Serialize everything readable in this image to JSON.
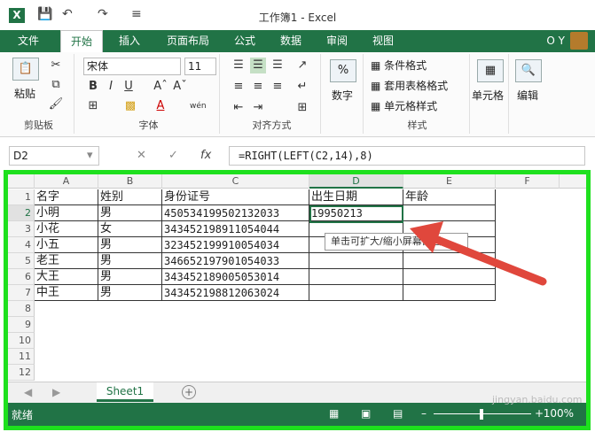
{
  "title_bar": {
    "doc_title": "工作簿1 - Excel",
    "logo": "X"
  },
  "tabs": [
    "文件",
    "开始",
    "插入",
    "页面布局",
    "公式",
    "数据",
    "审阅",
    "视图"
  ],
  "user": "O Y",
  "ribbon": {
    "paste": "粘贴",
    "clipboard": "剪贴板",
    "font_name": "宋体",
    "font_size": "11",
    "font_label": "字体",
    "bold": "B",
    "italic": "I",
    "underline": "U",
    "font_color_glyph": "A",
    "phonetic": "wén",
    "align_label": "对齐方式",
    "number_label": "数字",
    "conditional": "条件格式",
    "table_format": "套用表格格式",
    "cell_style": "单元格样式",
    "style_label": "样式",
    "cells": "单元格",
    "editing": "编辑"
  },
  "formula_bar": {
    "name_box": "D2",
    "fx": "fx",
    "formula": "=RIGHT(LEFT(C2,14),8)"
  },
  "columns": [
    "A",
    "B",
    "C",
    "D",
    "E",
    "F"
  ],
  "rows": [
    "1",
    "2",
    "3",
    "4",
    "5",
    "6",
    "7",
    "8",
    "9",
    "10",
    "11",
    "12"
  ],
  "table": {
    "headers": [
      "名字",
      "姓别",
      "身份证号",
      "出生日期",
      "年龄"
    ],
    "data": [
      [
        "小明",
        "男",
        "450534199502132033",
        "19950213"
      ],
      [
        "小花",
        "女",
        "343452198911054044",
        ""
      ],
      [
        "小五",
        "男",
        "323452199910054034",
        ""
      ],
      [
        "老王",
        "男",
        "346652197901054033",
        ""
      ],
      [
        "大王",
        "男",
        "343452189005053014",
        ""
      ],
      [
        "中王",
        "男",
        "343452198812063024",
        ""
      ]
    ]
  },
  "tooltip": "单击可扩大/缩小屏幕截图",
  "sheet_tab": "Sheet1",
  "status": "就绪",
  "zoom": "100%",
  "watermark": "jingyan.baidu.com",
  "colors": {
    "excel_green": "#217346",
    "highlight": "#1ee01e",
    "arrow": "#e0473c"
  }
}
